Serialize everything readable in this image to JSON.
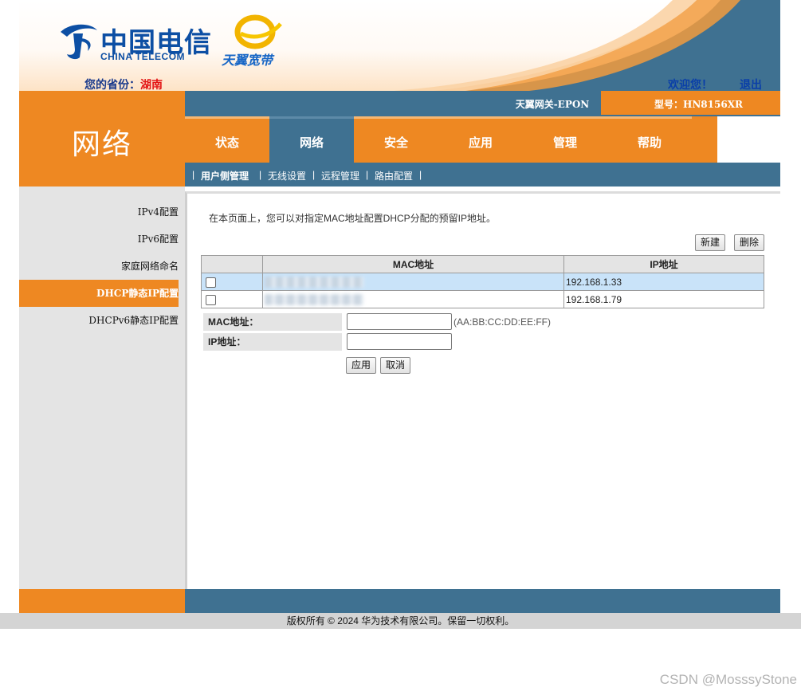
{
  "header": {
    "logo_cn": "中国电信",
    "logo_en": "CHINA TELECOM",
    "brand_cn": "天翼宽带",
    "province_label": "您的省份：",
    "province_value": "湖南",
    "welcome": "欢迎您！",
    "logout": "退出",
    "device_name": "天翼网关-EPON",
    "model": "型号：HN8156XR"
  },
  "section_title": "网络",
  "nav": {
    "tabs": [
      {
        "label": "状态"
      },
      {
        "label": "网络"
      },
      {
        "label": "安全"
      },
      {
        "label": "应用"
      },
      {
        "label": "管理"
      },
      {
        "label": "帮助"
      }
    ],
    "active": "网络"
  },
  "subnav": {
    "items": [
      "用户侧管理",
      "无线设置",
      "远程管理",
      "路由配置"
    ],
    "active": "用户侧管理"
  },
  "sidebar": {
    "items": [
      "IPv4配置",
      "IPv6配置",
      "家庭网络命名",
      "DHCP静态IP配置",
      "DHCPv6静态IP配置"
    ],
    "active": "DHCP静态IP配置"
  },
  "content": {
    "intro": "在本页面上，您可以对指定MAC地址配置DHCP分配的预留IP地址。",
    "new_button": "新建",
    "delete_button": "删除",
    "table": {
      "headers": [
        "MAC地址",
        "IP地址"
      ],
      "rows": [
        {
          "ip": "192.168.1.33",
          "selected": true
        },
        {
          "ip": "192.168.1.79",
          "selected": false
        }
      ]
    },
    "form": {
      "mac_label": "MAC地址：",
      "mac_hint": "(AA:BB:CC:DD:EE:FF)",
      "ip_label": "IP地址：",
      "apply_button": "应用",
      "cancel_button": "取消"
    }
  },
  "footer": {
    "copyright": "版权所有 © 2024 华为技术有限公司。保留一切权利。"
  },
  "watermark": "CSDN @MosssyStone",
  "colors": {
    "orange": "#ee8822",
    "steel_blue": "#3f7191",
    "selected_row": "#c9e3f9",
    "province_red": "#e31515",
    "link_blue": "#0a3fa8"
  }
}
